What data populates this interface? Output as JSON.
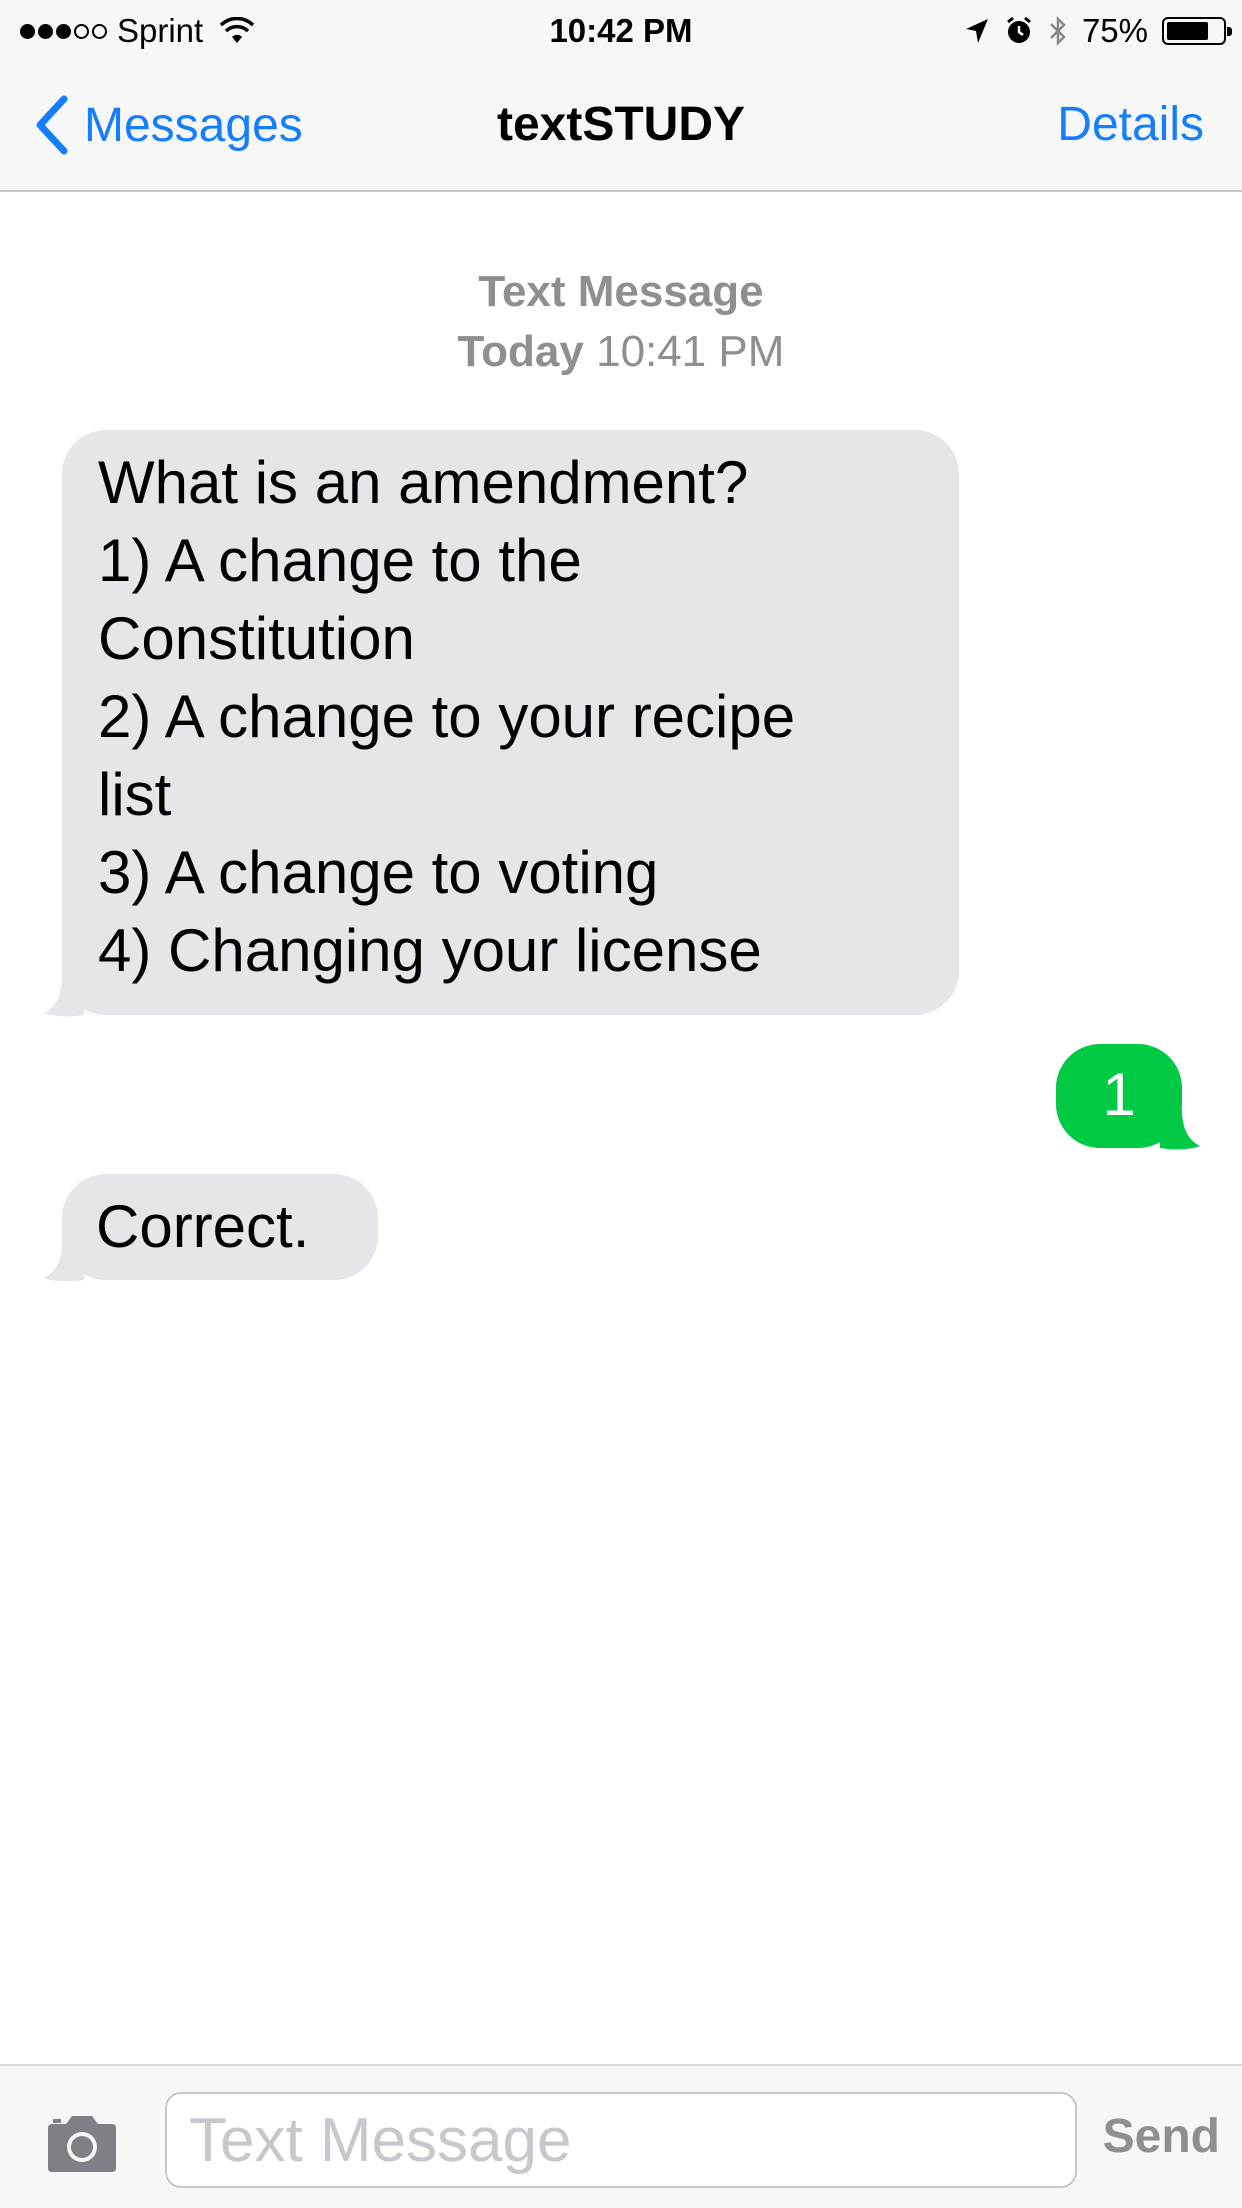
{
  "status_bar": {
    "signal_dots_filled": 3,
    "signal_dots_total": 5,
    "carrier": "Sprint",
    "time": "10:42 PM",
    "battery_percent": "75%",
    "battery_level": 0.75,
    "icons": [
      "wifi-icon",
      "location-arrow-icon",
      "alarm-icon",
      "bluetooth-icon",
      "battery-icon"
    ]
  },
  "nav": {
    "back_label": "Messages",
    "title": "textSTUDY",
    "details_label": "Details"
  },
  "thread": {
    "service_label": "Text Message",
    "day_label": "Today",
    "time_label": "10:41 PM"
  },
  "messages": [
    {
      "direction": "incoming",
      "lines": [
        "What is an amendment?",
        "1) A change to the",
        "Constitution",
        "2) A change to your recipe",
        "list",
        "3) A change to voting",
        "4) Changing your license"
      ]
    },
    {
      "direction": "outgoing",
      "lines": [
        "1"
      ]
    },
    {
      "direction": "incoming",
      "lines": [
        "Correct."
      ]
    }
  ],
  "compose": {
    "placeholder": "Text Message",
    "send_label": "Send"
  },
  "colors": {
    "accent": "#157efb",
    "incoming_bubble": "#e5e5ea",
    "outgoing_bubble": "#00c943",
    "secondary_text": "#8e8e93"
  }
}
